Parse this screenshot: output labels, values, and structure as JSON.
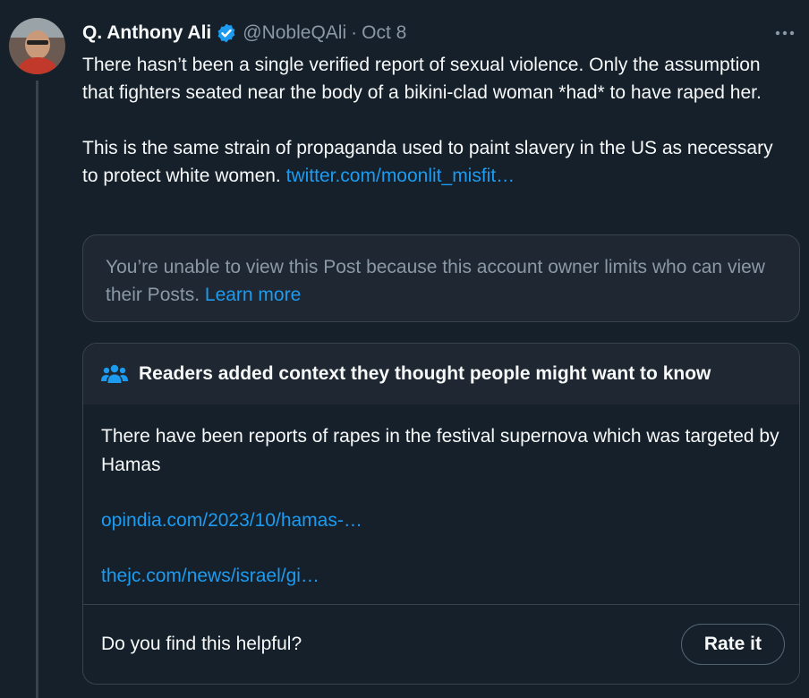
{
  "tweet": {
    "author_name": "Q. Anthony Ali",
    "handle": "@NobleQAli",
    "separator": "·",
    "date": "Oct 8",
    "more_icon": "more-horizontal-icon",
    "paragraph1": "There hasn’t been a single verified report of sexual violence. Only the assumption that fighters seated near the body of a bikini-clad woman *had* to have raped her.",
    "paragraph2": "This is the same strain of propaganda used to paint slavery in the US as necessary to protect white women.",
    "paragraph2_link": "twitter.com/moonlit_misfit…"
  },
  "quoted_post": {
    "message": "You’re unable to view this Post because this account owner limits who can view their Posts.",
    "learn_more": "Learn more"
  },
  "community_note": {
    "heading": "Readers added context they thought people might want to know",
    "text": "There have been reports of rapes in the festival supernova which was targeted by Hamas",
    "link1": "opindia.com/2023/10/hamas-…",
    "link2": "thejc.com/news/israel/gi…",
    "helpful_question": "Do you find this helpful?",
    "rate_button": "Rate it"
  },
  "colors": {
    "background": "#15202b",
    "link": "#1d9bf0",
    "muted": "#8b98a5",
    "border": "#38444d"
  }
}
